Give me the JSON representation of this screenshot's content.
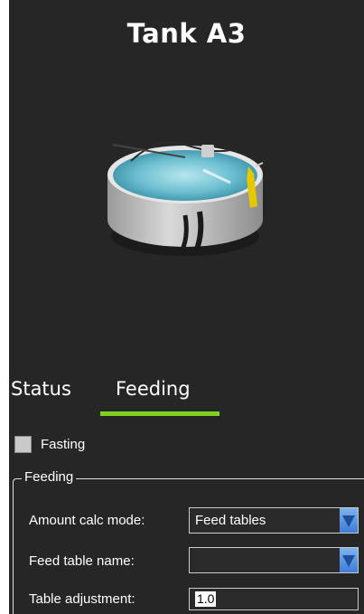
{
  "header": {
    "title": "Tank A3"
  },
  "tabs": [
    {
      "label": "Status",
      "selected": false
    },
    {
      "label": "Feeding",
      "selected": true
    }
  ],
  "fasting": {
    "label": "Fasting",
    "checked": false
  },
  "feeding_group": {
    "legend": "Feeding",
    "amount_calc_mode": {
      "label": "Amount calc mode:",
      "value": "Feed tables"
    },
    "feed_table_name": {
      "label": "Feed table name:",
      "value": ""
    },
    "table_adjustment": {
      "label": "Table adjustment:",
      "value": "1.0"
    }
  },
  "colors": {
    "panel_bg": "#262626",
    "tab_accent": "#7ed321",
    "dropdown_button": "#3d7cd6"
  }
}
